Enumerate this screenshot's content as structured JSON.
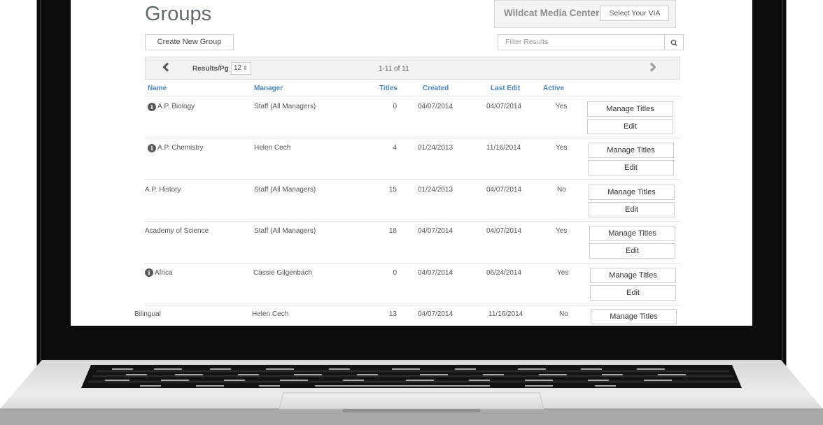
{
  "page": {
    "title": "Groups"
  },
  "via": {
    "name": "Wildcat Media Center",
    "select_label": "Select Your VIA"
  },
  "toolbar": {
    "create_label": "Create New Group",
    "filter_placeholder": "Filter Results",
    "search_icon": "search-icon"
  },
  "pager": {
    "prev_icon": "chevron-left-icon",
    "next_icon": "chevron-right-icon",
    "results_label": "Results/Pg",
    "page_size": "12",
    "range": "1-11 of 11"
  },
  "table": {
    "headers": {
      "name": "Name",
      "manager": "Manager",
      "titles": "Titles",
      "created": "Created",
      "last_edit": "Last Edit",
      "active": "Active"
    },
    "manage_label": "Manage Titles",
    "edit_label": "Edit",
    "rows": [
      {
        "name": "A.P. Biology",
        "info": true,
        "manager": "Staff (All Managers)",
        "titles": "0",
        "created": "04/07/2014",
        "last_edit": "04/07/2014",
        "active": "Yes"
      },
      {
        "name": "A.P. Chemistry",
        "info": true,
        "manager": "Helen Cech",
        "titles": "4",
        "created": "01/24/2013",
        "last_edit": "11/16/2014",
        "active": "Yes"
      },
      {
        "name": "A.P. History",
        "info": false,
        "manager": "Staff (All Managers)",
        "titles": "15",
        "created": "01/24/2013",
        "last_edit": "04/07/2014",
        "active": "No"
      },
      {
        "name": "Academy of Science",
        "info": false,
        "manager": "Staff (All Managers)",
        "titles": "18",
        "created": "04/07/2014",
        "last_edit": "04/07/2014",
        "active": "Yes"
      },
      {
        "name": "Africa",
        "info": true,
        "manager": "Cassie Gilgenbach",
        "titles": "0",
        "created": "04/07/2014",
        "last_edit": "06/24/2014",
        "active": "Yes"
      },
      {
        "name": "Bilingual",
        "info": false,
        "manager": "Helen Cech",
        "titles": "13",
        "created": "04/07/2014",
        "last_edit": "11/16/2014",
        "active": "No"
      }
    ]
  }
}
